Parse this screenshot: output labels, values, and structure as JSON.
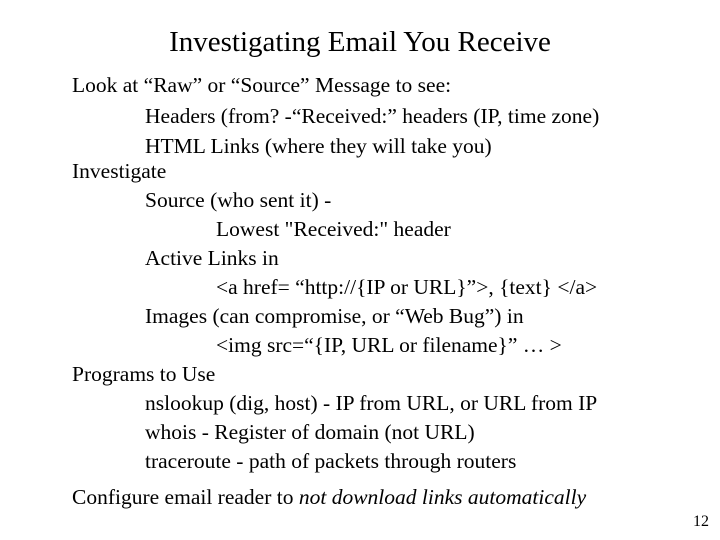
{
  "slide": {
    "title": "Investigating Email You Receive",
    "lines": [
      {
        "level": 0,
        "text": "Look at “Raw” or “Source” Message to see:"
      },
      {
        "level": 1,
        "text": "Headers (from? -“Received:” headers (IP, time zone)"
      },
      {
        "level": 1,
        "text": "HTML Links (where they will take you)"
      },
      {
        "level": 0,
        "text": "Investigate"
      },
      {
        "level": 1,
        "text": "Source (who sent it) -"
      },
      {
        "level": 2,
        "text": "Lowest \"Received:\"  header"
      },
      {
        "level": 1,
        "text": "Active Links in"
      },
      {
        "level": 2,
        "text": "<a href= “http://{IP or URL}”>, {text} </a>"
      },
      {
        "level": 1,
        "text": "Images (can compromise, or “Web Bug”) in"
      },
      {
        "level": 2,
        "text": "<img src=“{IP, URL or filename}” … >"
      },
      {
        "level": 0,
        "text": "Programs to Use"
      },
      {
        "level": 1,
        "text": "nslookup (dig, host) - IP from URL, or URL from IP"
      },
      {
        "level": 1,
        "text": "whois - Register of domain (not URL)"
      },
      {
        "level": 1,
        "text": "traceroute - path of packets through routers"
      }
    ],
    "final_line": {
      "plain": "Configure email reader to ",
      "italic": "not download links automatically"
    },
    "page_number": "12"
  }
}
